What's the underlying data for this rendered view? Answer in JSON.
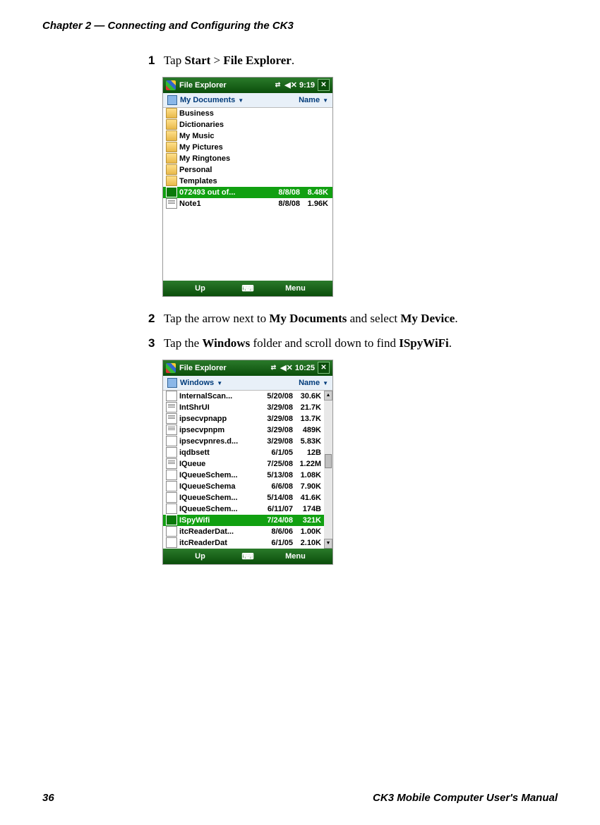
{
  "header": {
    "chapter": "Chapter 2 — Connecting and Configuring the CK3"
  },
  "footer": {
    "page": "36",
    "manual": "CK3 Mobile Computer User's Manual"
  },
  "steps": {
    "s1": {
      "num": "1",
      "pre": "Tap ",
      "b1": "Start",
      "mid": " > ",
      "b2": "File Explorer",
      "post": "."
    },
    "s2": {
      "num": "2",
      "pre": "Tap the arrow next to ",
      "b1": "My Documents",
      "mid": " and select ",
      "b2": "My Device",
      "post": "."
    },
    "s3": {
      "num": "3",
      "pre": "Tap the ",
      "b1": "Windows",
      "mid": " folder and scroll down to find ",
      "b2": "ISpyWiFi",
      "post": "."
    }
  },
  "shot1": {
    "title": "File Explorer",
    "time": "9:19",
    "loc": "My Documents",
    "sort": "Name",
    "rows": [
      {
        "icon": "folder",
        "name": "Business",
        "date": "",
        "size": ""
      },
      {
        "icon": "folder",
        "name": "Dictionaries",
        "date": "",
        "size": ""
      },
      {
        "icon": "folder",
        "name": "My Music",
        "date": "",
        "size": ""
      },
      {
        "icon": "folder",
        "name": "My Pictures",
        "date": "",
        "size": ""
      },
      {
        "icon": "folder",
        "name": "My Ringtones",
        "date": "",
        "size": ""
      },
      {
        "icon": "folder",
        "name": "Personal",
        "date": "",
        "size": ""
      },
      {
        "icon": "folder",
        "name": "Templates",
        "date": "",
        "size": ""
      },
      {
        "icon": "sel",
        "name": "072493 out of...",
        "date": "8/8/08",
        "size": "8.48K",
        "sel": true
      },
      {
        "icon": "doc",
        "name": "Note1",
        "date": "8/8/08",
        "size": "1.96K"
      }
    ],
    "up": "Up",
    "menu": "Menu"
  },
  "shot2": {
    "title": "File Explorer",
    "time": "10:25",
    "loc": "Windows",
    "sort": "Name",
    "rows": [
      {
        "icon": "app",
        "name": "InternalScan...",
        "date": "5/20/08",
        "size": "30.6K"
      },
      {
        "icon": "doc",
        "name": "IntShrUI",
        "date": "3/29/08",
        "size": "21.7K"
      },
      {
        "icon": "doc",
        "name": "ipsecvpnapp",
        "date": "3/29/08",
        "size": "13.7K"
      },
      {
        "icon": "doc",
        "name": "ipsecvpnpm",
        "date": "3/29/08",
        "size": "489K"
      },
      {
        "icon": "app",
        "name": "ipsecvpnres.d...",
        "date": "3/29/08",
        "size": "5.83K"
      },
      {
        "icon": "app",
        "name": "iqdbsett",
        "date": "6/1/05",
        "size": "12B"
      },
      {
        "icon": "doc",
        "name": "IQueue",
        "date": "7/25/08",
        "size": "1.22M"
      },
      {
        "icon": "app",
        "name": "IQueueSchem...",
        "date": "5/13/08",
        "size": "1.08K"
      },
      {
        "icon": "app",
        "name": "IQueueSchema",
        "date": "6/6/08",
        "size": "7.90K"
      },
      {
        "icon": "app",
        "name": "IQueueSchem...",
        "date": "5/14/08",
        "size": "41.6K"
      },
      {
        "icon": "app",
        "name": "IQueueSchem...",
        "date": "6/11/07",
        "size": "174B"
      },
      {
        "icon": "sel",
        "name": "ISpyWifi",
        "date": "7/24/08",
        "size": "321K",
        "sel": true
      },
      {
        "icon": "app",
        "name": "itcReaderDat...",
        "date": "8/6/06",
        "size": "1.00K"
      },
      {
        "icon": "app",
        "name": "itcReaderDat",
        "date": "6/1/05",
        "size": "2.10K"
      }
    ],
    "up": "Up",
    "menu": "Menu"
  }
}
